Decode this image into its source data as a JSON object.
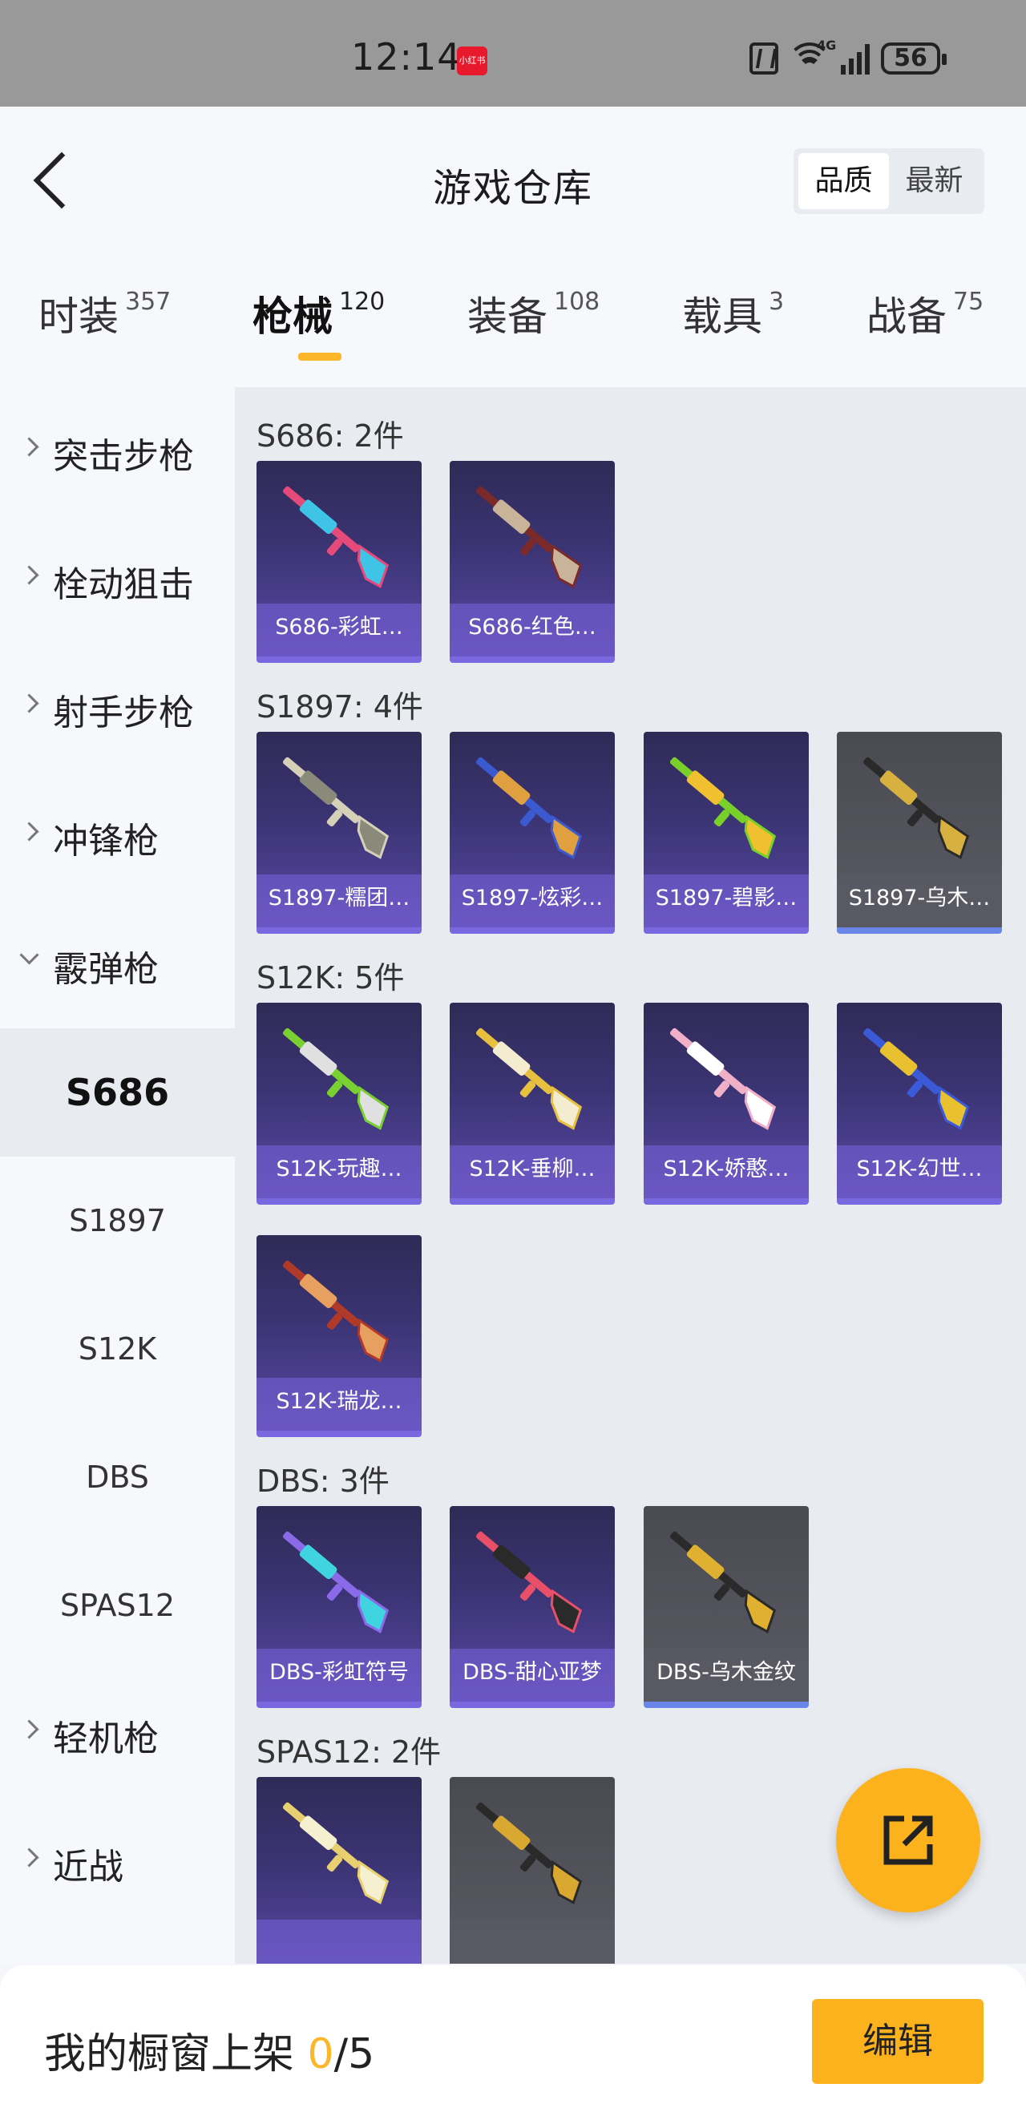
{
  "status_bar": {
    "time": "12:14",
    "app_badge": "小红书",
    "network": "4G",
    "battery": "56"
  },
  "header": {
    "title": "游戏仓库",
    "sort": {
      "quality_label": "品质",
      "newest_label": "最新",
      "selected": "品质"
    }
  },
  "tabs": [
    {
      "label": "时装",
      "count": "357"
    },
    {
      "label": "枪械",
      "count": "120",
      "active": true
    },
    {
      "label": "装备",
      "count": "108"
    },
    {
      "label": "载具",
      "count": "3"
    },
    {
      "label": "战备",
      "count": "75"
    }
  ],
  "sidebar": {
    "categories": [
      "突击步枪",
      "栓动狙击",
      "射手步枪",
      "冲锋枪",
      "霰弹枪",
      "轻机枪",
      "近战"
    ],
    "shotgun_subs": [
      "S686",
      "S1897",
      "S12K",
      "DBS",
      "SPAS12"
    ],
    "active_sub": "S686"
  },
  "groups": [
    {
      "title": "S686: 2件",
      "items": [
        {
          "name": "S686-彩虹…",
          "rarity": "purple",
          "colors": [
            "#e64a7a",
            "#3fc4e8"
          ]
        },
        {
          "name": "S686-红色…",
          "rarity": "purple",
          "colors": [
            "#7a2a2a",
            "#c9b49a"
          ]
        }
      ]
    },
    {
      "title": "S1897: 4件",
      "items": [
        {
          "name": "S1897-糯团…",
          "rarity": "purple",
          "colors": [
            "#d7d0b8",
            "#8a8a7a"
          ]
        },
        {
          "name": "S1897-炫彩…",
          "rarity": "purple",
          "colors": [
            "#3b5ad0",
            "#e0a040"
          ]
        },
        {
          "name": "S1897-碧影…",
          "rarity": "purple",
          "colors": [
            "#7ad02a",
            "#f0c030"
          ]
        },
        {
          "name": "S1897-乌木…",
          "rarity": "grey",
          "colors": [
            "#2a2a2a",
            "#d8b040"
          ]
        }
      ]
    },
    {
      "title": "S12K: 5件",
      "items": [
        {
          "name": "S12K-玩趣…",
          "rarity": "purple",
          "colors": [
            "#7ad030",
            "#e0e0e0"
          ]
        },
        {
          "name": "S12K-垂柳…",
          "rarity": "purple",
          "colors": [
            "#e8c040",
            "#f4ecd0"
          ]
        },
        {
          "name": "S12K-娇憨…",
          "rarity": "purple",
          "colors": [
            "#f0b0c8",
            "#ffffff"
          ]
        },
        {
          "name": "S12K-幻世…",
          "rarity": "purple",
          "colors": [
            "#3a5ad8",
            "#e8c030"
          ]
        },
        {
          "name": "S12K-瑞龙…",
          "rarity": "purple",
          "colors": [
            "#b03a2a",
            "#e8a060"
          ]
        }
      ]
    },
    {
      "title": "DBS: 3件",
      "items": [
        {
          "name": "DBS-彩虹符号",
          "rarity": "purple",
          "colors": [
            "#8a6ae8",
            "#3fd4e0"
          ]
        },
        {
          "name": "DBS-甜心亚梦",
          "rarity": "purple",
          "colors": [
            "#e8506a",
            "#2a2a2a"
          ]
        },
        {
          "name": "DBS-乌木金纹",
          "rarity": "grey",
          "colors": [
            "#2a2a2a",
            "#e0b030"
          ]
        }
      ]
    },
    {
      "title": "SPAS12: 2件",
      "items": [
        {
          "name": "",
          "rarity": "purple",
          "colors": [
            "#e8d070",
            "#f4f0d0"
          ]
        },
        {
          "name": "",
          "rarity": "grey",
          "colors": [
            "#2a2a2a",
            "#d8a830"
          ]
        }
      ]
    }
  ],
  "footer": {
    "shelf_label": "我的橱窗上架",
    "shelf_current": "0",
    "shelf_total": "/5",
    "edit_label": "编辑"
  },
  "share_button_icon": "share-external-icon"
}
